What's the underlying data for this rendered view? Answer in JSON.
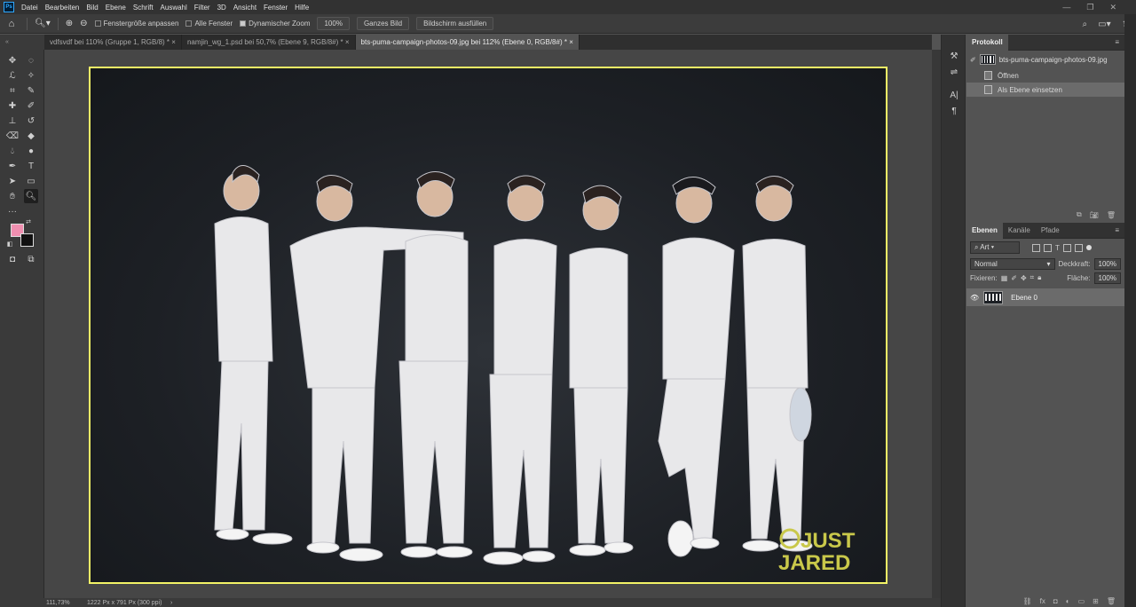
{
  "menubar": {
    "app_logo": "Ps",
    "items": [
      "Datei",
      "Bearbeiten",
      "Bild",
      "Ebene",
      "Schrift",
      "Auswahl",
      "Filter",
      "3D",
      "Ansicht",
      "Fenster",
      "Hilfe"
    ]
  },
  "options": {
    "resize_windows": "Fenstergröße anpassen",
    "all_windows": "Alle Fenster",
    "dynamic_zoom": "Dynamischer Zoom",
    "zoom_value": "100%",
    "fit_screen": "Ganzes Bild",
    "fill_screen": "Bildschirm ausfüllen"
  },
  "tabs": [
    "vdfsvdf bei 110% (Gruppe 1, RGB/8) *",
    "namjin_wg_1.psd bei 50,7% (Ebene 9, RGB/8#) *",
    "bts-puma-campaign-photos-09.jpg bei 112% (Ebene 0, RGB/8#) *"
  ],
  "canvas": {
    "watermark_line1": "JUST",
    "watermark_line2": "JARED"
  },
  "status": {
    "zoom": "111,73%",
    "dimensions": "1222 Px x 791 Px (300 ppi)",
    "arrow": "›"
  },
  "history": {
    "tab": "Protokoll",
    "snapshot": "bts-puma-campaign-photos-09.jpg",
    "steps": [
      "Öffnen",
      "Als Ebene einsetzen"
    ]
  },
  "layers": {
    "tabs": [
      "Ebenen",
      "Kanäle",
      "Pfade"
    ],
    "filter_kind": "Art",
    "blend_mode": "Normal",
    "opacity_label": "Deckkraft:",
    "opacity_value": "100%",
    "lock_label": "Fixieren:",
    "fill_label": "Fläche:",
    "fill_value": "100%",
    "layer_name": "Ebene 0"
  },
  "colors": {
    "foreground": "#f08fb0",
    "background": "#111111",
    "canvas_border": "#f3f366",
    "watermark": "#c9c84a"
  }
}
